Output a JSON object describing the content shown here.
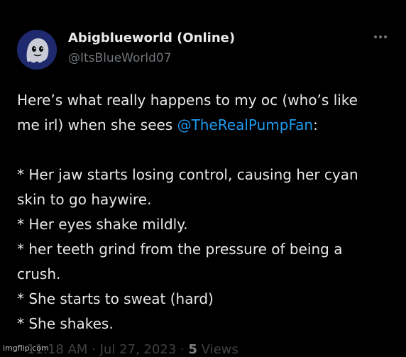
{
  "post": {
    "display_name": "Abigblueworld (Online)",
    "handle": "@ItsBlueWorld07",
    "more_icon": "more-horizontal-icon",
    "lines": {
      "l1": "Here’s what really happens to my oc (who’s like",
      "l2_prefix": "me irl) when she sees ",
      "l2_mention": "@TheRealPumpFan",
      "l2_suffix": ":",
      "l3": "* Her jaw starts losing control, causing her cyan",
      "l4": "skin to go haywire.",
      "l5": "* Her eyes shake mildly.",
      "l6": "* her teeth grind from the pressure of being a",
      "l7": "crush.",
      "l8": "* She starts to sweat (hard)",
      "l9": "* She shakes."
    },
    "meta": {
      "time": "11:18 AM",
      "separator": " · ",
      "date": "Jul 27, 2023",
      "views_count": "5",
      "views_label": " Views"
    }
  },
  "watermark": "imgflip.com",
  "colors": {
    "background": "#000000",
    "text": "#e7e9ea",
    "secondary": "#71767b",
    "mention": "#1d9bf0"
  }
}
